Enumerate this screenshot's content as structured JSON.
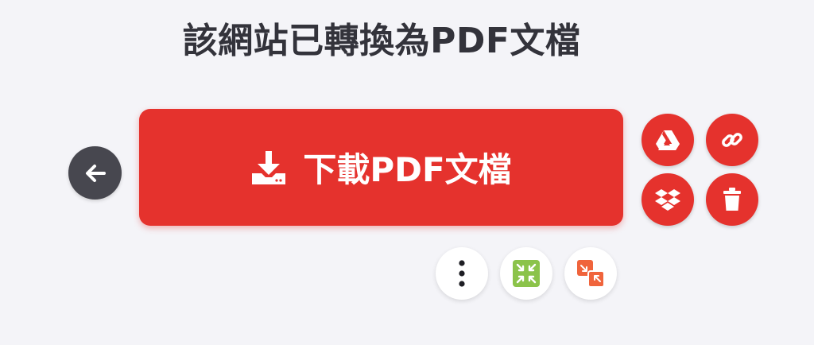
{
  "header": {
    "title": "該網站已轉換為PDF文檔"
  },
  "actions": {
    "download_label": "下載PDF文檔",
    "back_icon": "arrow-left-icon",
    "download_icon": "download-icon"
  },
  "side_actions": [
    {
      "icon": "google-drive-icon"
    },
    {
      "icon": "link-icon"
    },
    {
      "icon": "dropbox-icon"
    },
    {
      "icon": "trash-icon"
    }
  ],
  "bottom_actions": [
    {
      "icon": "more-vertical-icon"
    },
    {
      "icon": "compress-pdf-icon"
    },
    {
      "icon": "convert-pdf-icon"
    }
  ],
  "colors": {
    "accent": "#e5322d",
    "back_button": "#47474f",
    "title_text": "#33333b",
    "background": "#f4f4f8",
    "compress_green": "#8bc34a",
    "convert_orange": "#f0643c"
  }
}
